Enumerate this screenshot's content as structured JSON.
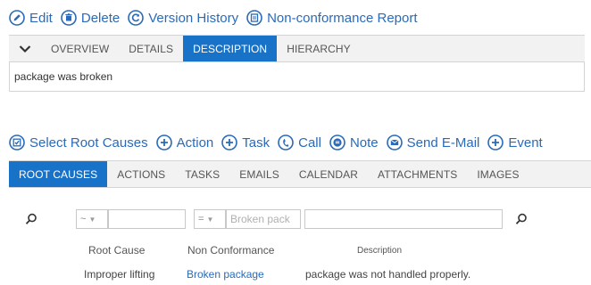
{
  "top_toolbar": {
    "items": [
      {
        "label": "Edit",
        "icon": "edit-icon"
      },
      {
        "label": "Delete",
        "icon": "trash-icon"
      },
      {
        "label": "Version History",
        "icon": "history-icon"
      },
      {
        "label": "Non-conformance Report",
        "icon": "report-icon"
      }
    ]
  },
  "top_tabs": {
    "items": [
      "OVERVIEW",
      "DETAILS",
      "DESCRIPTION",
      "HIERARCHY"
    ],
    "active": "DESCRIPTION"
  },
  "description_text": "package was broken",
  "rc_toolbar": {
    "items": [
      {
        "label": "Select Root Causes",
        "icon": "select-icon"
      },
      {
        "label": "Action",
        "icon": "plus-circle-icon"
      },
      {
        "label": "Task",
        "icon": "plus-circle-icon"
      },
      {
        "label": "Call",
        "icon": "phone-icon"
      },
      {
        "label": "Note",
        "icon": "note-icon"
      },
      {
        "label": "Send E-Mail",
        "icon": "mail-icon"
      },
      {
        "label": "Event",
        "icon": "plus-circle-icon"
      }
    ]
  },
  "rc_tabs": {
    "items": [
      "ROOT CAUSES",
      "ACTIONS",
      "TASKS",
      "EMAILS",
      "CALENDAR",
      "ATTACHMENTS",
      "IMAGES"
    ],
    "active": "ROOT CAUSES"
  },
  "filters": {
    "root_cause_operator": "~",
    "root_cause_value": "",
    "nc_operator": "=",
    "nc_value": "Broken pack",
    "description_value": ""
  },
  "table": {
    "headers": [
      "Root Cause",
      "Non Conformance",
      "Description"
    ],
    "rows": [
      {
        "root_cause": "Improper lifting",
        "non_conformance": "Broken package",
        "description": "package was not handled properly."
      }
    ]
  },
  "colors": {
    "accent": "#1873c8",
    "link": "#2a6ab8",
    "tab_bg": "#f2f2f2",
    "border": "#d4d4d4"
  }
}
